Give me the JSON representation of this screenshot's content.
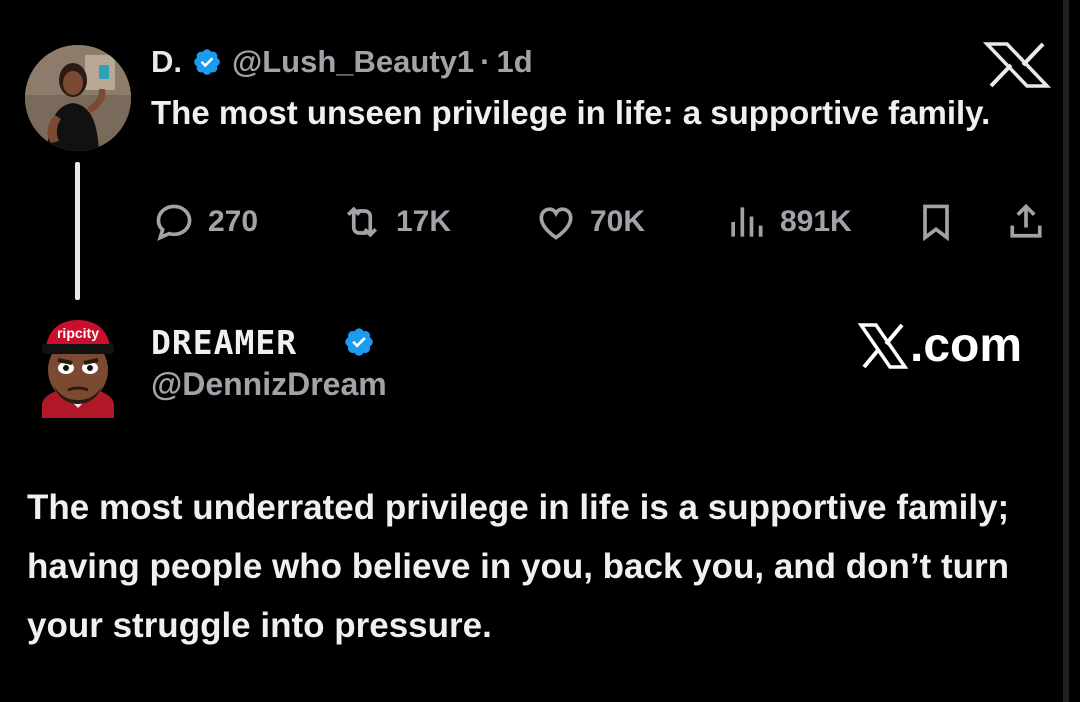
{
  "parent_tweet": {
    "name": "D.",
    "handle": "@Lush_Beauty1",
    "separator": "·",
    "age": "1d",
    "text": "The most unseen privilege in life: a supportive family.",
    "metrics": {
      "replies": "270",
      "reposts": "17K",
      "likes": "70K",
      "views": "891K"
    }
  },
  "reply_tweet": {
    "name": "DREAMER",
    "handle": "@DennizDream",
    "source_label": ".com",
    "avatar_cap_text": "ripcity",
    "text": "The most underrated privilege in life is a supportive family; having people who believe in you, back you, and don’t turn your struggle into pressure."
  },
  "icons": {
    "close": "x-logo-icon",
    "verified": "verified-badge-icon",
    "reply": "reply-icon",
    "repost": "repost-icon",
    "like": "heart-icon",
    "views": "views-icon",
    "bookmark": "bookmark-icon",
    "share": "share-icon"
  },
  "colors": {
    "background": "#000000",
    "text": "#e7e9ea",
    "muted": "#a0a4a8",
    "verified": "#1d9bf0"
  }
}
